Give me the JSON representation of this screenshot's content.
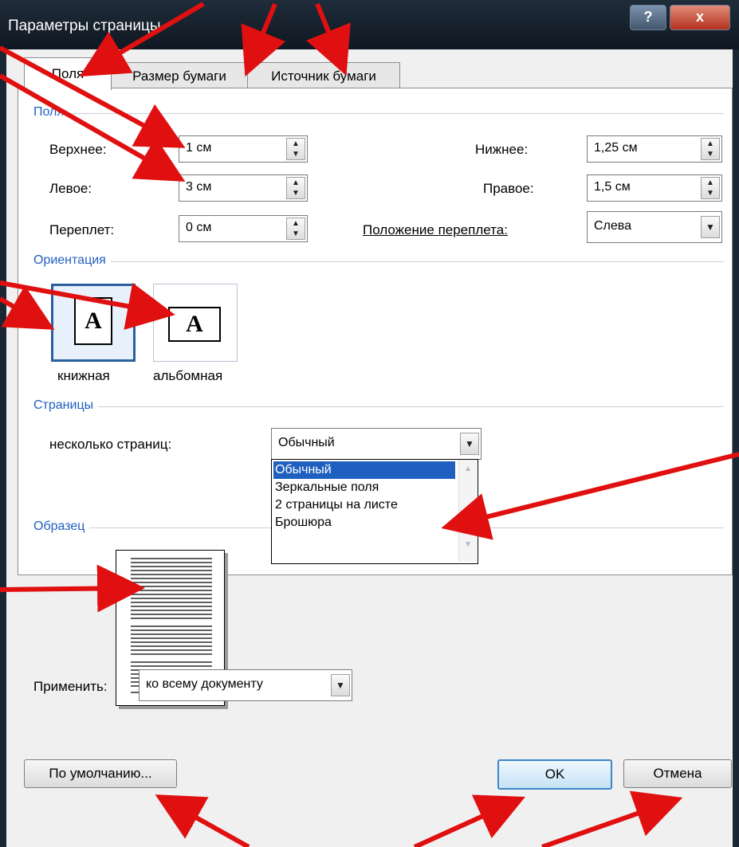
{
  "window": {
    "title": "Параметры страницы",
    "help_label": "?",
    "close_label": "x"
  },
  "tabs": [
    {
      "label": "Поля",
      "active": true
    },
    {
      "label": "Размер бумаги",
      "active": false
    },
    {
      "label": "Источник бумаги",
      "active": false
    }
  ],
  "margins": {
    "heading": "Поля",
    "top_label": "Верхнее:",
    "top_value": "1 см",
    "bottom_label": "Нижнее:",
    "bottom_value": "1,25 см",
    "left_label": "Левое:",
    "left_value": "3 см",
    "right_label": "Правое:",
    "right_value": "1,5 см",
    "gutter_label": "Переплет:",
    "gutter_value": "0 см",
    "gutter_pos_label": "Положение переплета:",
    "gutter_pos_value": "Слева"
  },
  "orientation": {
    "heading": "Ориентация",
    "portrait_label": "книжная",
    "landscape_label": "альбомная",
    "selected": "книжная",
    "glyph": "A"
  },
  "pages": {
    "heading": "Страницы",
    "multiple_label": "несколько страниц:",
    "multiple_value": "Обычный",
    "options": [
      "Обычный",
      "Зеркальные поля",
      "2 страницы на листе",
      "Брошюра"
    ]
  },
  "preview": {
    "heading": "Образец"
  },
  "apply": {
    "label": "Применить:",
    "value": "ко всему документу"
  },
  "buttons": {
    "default_label": "По умолчанию...",
    "ok_label": "OK",
    "cancel_label": "Отмена"
  },
  "colors": {
    "accent": "#1f5fbf",
    "arrow": "#e01010",
    "titlebar": "#15202b"
  }
}
